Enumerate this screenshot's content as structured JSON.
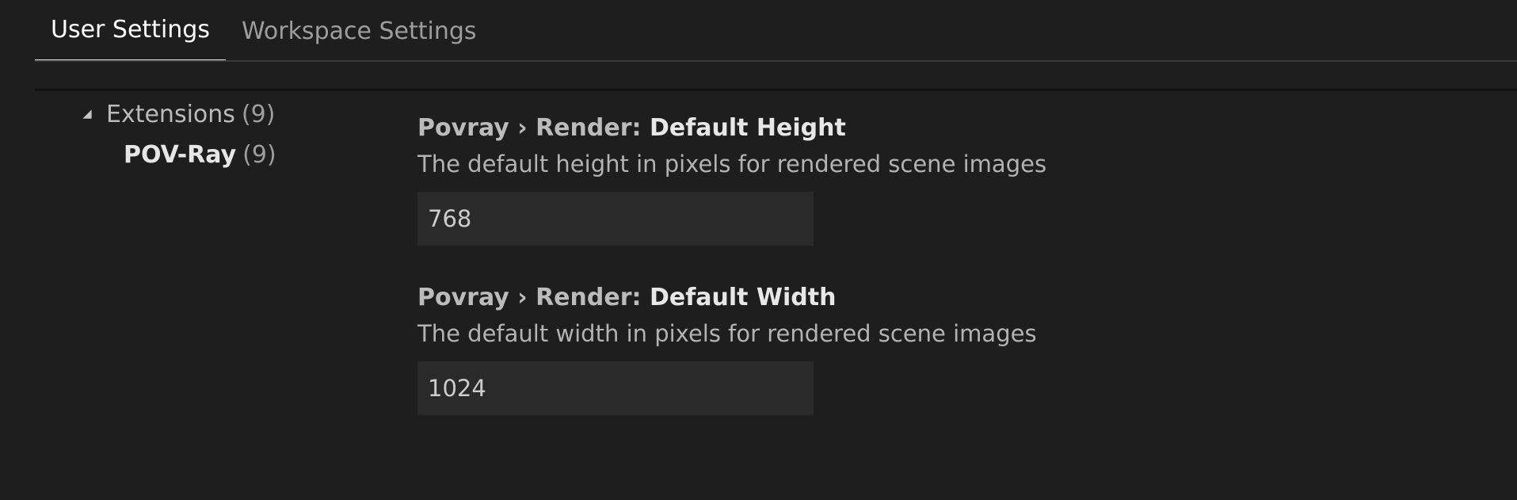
{
  "tabs": [
    {
      "label": "User Settings",
      "active": true
    },
    {
      "label": "Workspace Settings",
      "active": false
    }
  ],
  "toc": {
    "group_label": "Extensions",
    "group_count": "(9)",
    "item_label": "POV-Ray",
    "item_count": "(9)"
  },
  "settings": [
    {
      "category": "Povray › Render: ",
      "key": "Default Height",
      "description": "The default height in pixels for rendered scene images",
      "value": "768"
    },
    {
      "category": "Povray › Render: ",
      "key": "Default Width",
      "description": "The default width in pixels for rendered scene images",
      "value": "1024"
    }
  ],
  "colors": {
    "background": "#1e1e1e",
    "input_background": "#2a2a2a",
    "active_tab_border": "#e7e7e7"
  }
}
